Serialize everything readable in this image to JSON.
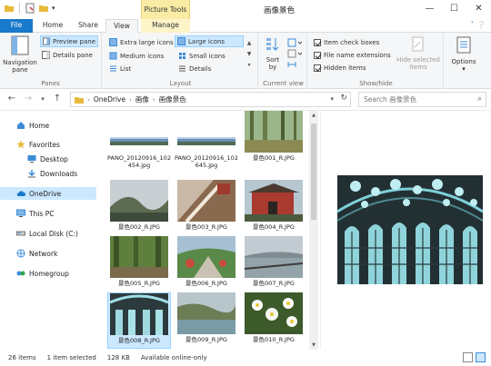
{
  "window": {
    "title": "画像景色",
    "context_tab": "Picture Tools",
    "minimize": "—",
    "maximize": "☐",
    "close": "✕"
  },
  "tabs": {
    "file": "File",
    "home": "Home",
    "share": "Share",
    "view": "View",
    "manage": "Manage"
  },
  "ribbon": {
    "panes": {
      "navigation_pane": "Navigation pane",
      "preview_pane": "Preview pane",
      "details_pane": "Details pane",
      "label": "Panes"
    },
    "layout": {
      "extra_large": "Extra large icons",
      "large": "Large icons",
      "medium": "Medium icons",
      "small": "Small icons",
      "list": "List",
      "details": "Details",
      "label": "Layout"
    },
    "current_view": {
      "sort_by": "Sort by",
      "label": "Current view"
    },
    "show_hide": {
      "item_check_boxes": "Item check boxes",
      "file_name_extensions": "File name extensions",
      "hidden_items": "Hidden items",
      "hide_selected": "Hide selected items",
      "label": "Show/hide"
    },
    "options": "Options"
  },
  "address": {
    "crumbs": [
      "OneDrive",
      "画像",
      "画像景色"
    ],
    "search_placeholder": "Search 画像景色"
  },
  "nav": {
    "home": "Home",
    "favorites": "Favorites",
    "desktop": "Desktop",
    "downloads": "Downloads",
    "onedrive": "OneDrive",
    "thispc": "This PC",
    "localdisk": "Local Disk (C:)",
    "network": "Network",
    "homegroup": "Homegroup"
  },
  "files": [
    {
      "name": "PANO_20120916_102454.jpg"
    },
    {
      "name": "PANO_20120916_102645.jpg"
    },
    {
      "name": "景色001_R.JPG"
    },
    {
      "name": "景色002_R.JPG"
    },
    {
      "name": "景色003_R.JPG"
    },
    {
      "name": "景色004_R.JPG"
    },
    {
      "name": "景色005_R.JPG"
    },
    {
      "name": "景色006_R.JPG"
    },
    {
      "name": "景色007_R.JPG"
    },
    {
      "name": "景色008_R.JPG"
    },
    {
      "name": "景色009_R.JPG"
    },
    {
      "name": "景色010_R.JPG"
    }
  ],
  "status": {
    "items": "26 items",
    "selected": "1 item selected",
    "size": "128 KB",
    "availability": "Available online-only"
  }
}
